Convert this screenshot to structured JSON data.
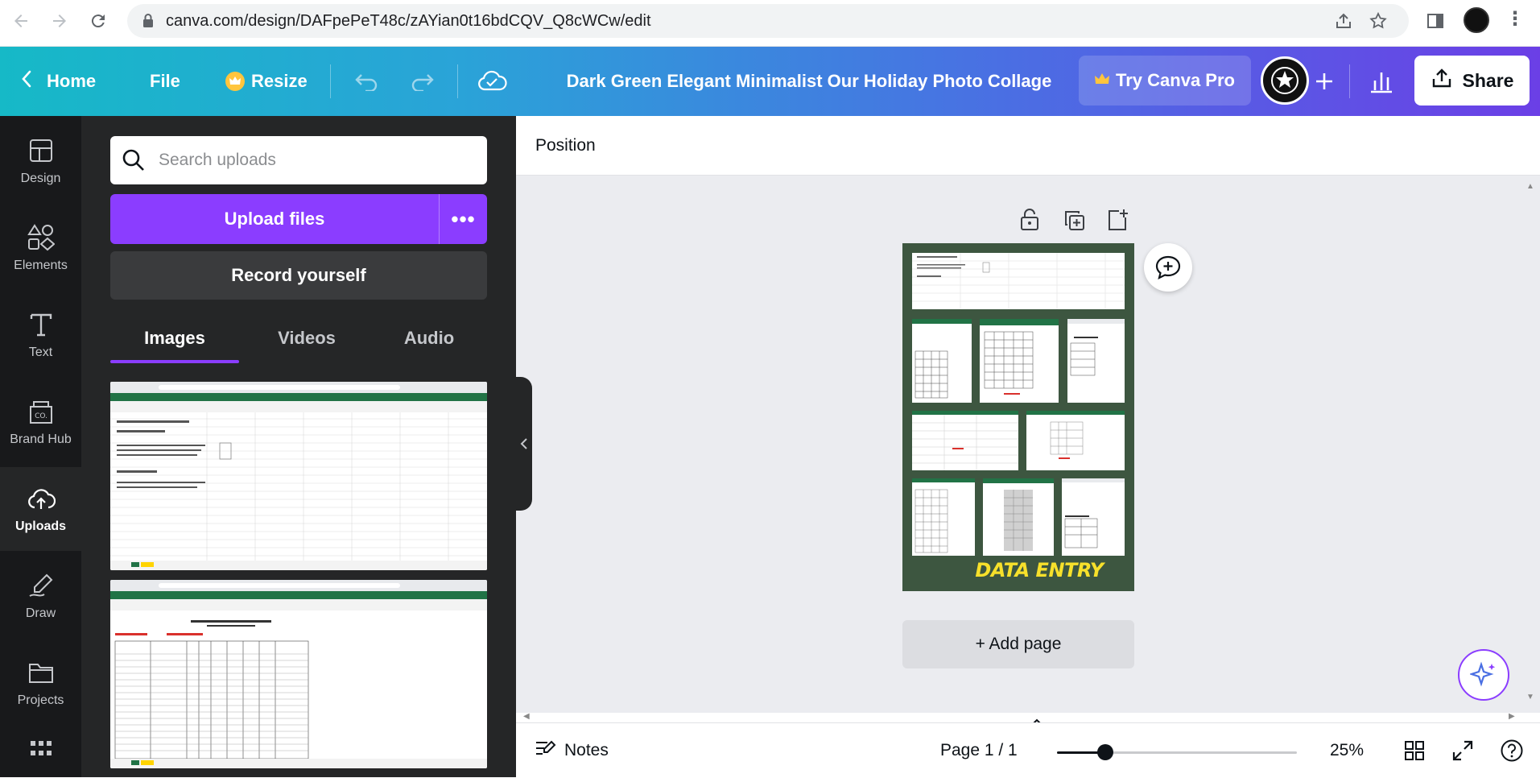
{
  "browser": {
    "url": "canva.com/design/DAFpePeT48c/zAYian0t16bdCQV_Q8cWCw/edit"
  },
  "topbar": {
    "home_label": "Home",
    "file_label": "File",
    "resize_label": "Resize",
    "design_title": "Dark Green Elegant Minimalist Our Holiday Photo Collage",
    "try_pro_label": "Try Canva Pro",
    "share_label": "Share",
    "accent": "#8b3dff"
  },
  "rail": {
    "items": [
      {
        "label": "Design",
        "icon": "layout-icon"
      },
      {
        "label": "Elements",
        "icon": "shapes-icon"
      },
      {
        "label": "Text",
        "icon": "text-icon"
      },
      {
        "label": "Brand Hub",
        "icon": "brand-hub-icon"
      },
      {
        "label": "Uploads",
        "icon": "cloud-upload-icon",
        "active": true
      },
      {
        "label": "Draw",
        "icon": "pen-icon"
      },
      {
        "label": "Projects",
        "icon": "folder-icon"
      }
    ]
  },
  "panel": {
    "search_placeholder": "Search uploads",
    "upload_label": "Upload files",
    "record_label": "Record yourself",
    "tabs": [
      {
        "label": "Images",
        "active": true
      },
      {
        "label": "Videos"
      },
      {
        "label": "Audio"
      }
    ]
  },
  "canvas": {
    "position_label": "Position",
    "add_page_label": "+ Add page",
    "page_bg": "#3d5640",
    "design_text": "DATA ENTRY"
  },
  "bottom": {
    "notes_label": "Notes",
    "page_indicator": "Page 1 / 1",
    "zoom_percent": 25,
    "zoom_label": "25%",
    "zoom_fraction": 0.2
  }
}
